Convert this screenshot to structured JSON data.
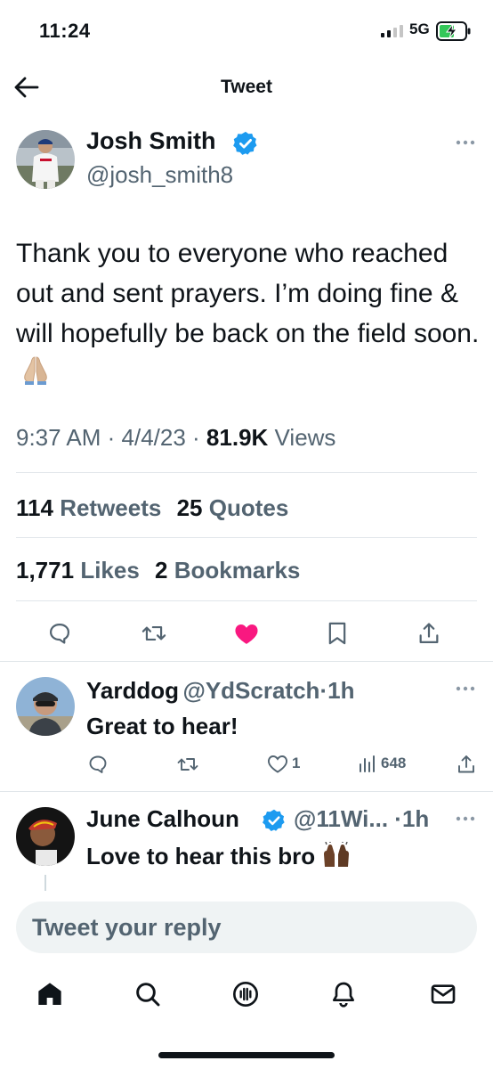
{
  "status_bar": {
    "time": "11:24",
    "network": "5G"
  },
  "header": {
    "title": "Tweet"
  },
  "tweet": {
    "author_name": "Josh Smith",
    "author_handle": "@josh_smith8",
    "text": "Thank you to everyone who reached out and sent prayers. I’m doing fine & will hopefully be back on the field soon.",
    "time": "9:37 AM",
    "date": "4/4/23",
    "views_count": "81.9K",
    "views_label": "Views",
    "retweets_count": "114",
    "retweets_label": "Retweets",
    "quotes_count": "25",
    "quotes_label": "Quotes",
    "likes_count": "1,771",
    "likes_label": "Likes",
    "bookmarks_count": "2",
    "bookmarks_label": "Bookmarks",
    "liked": true
  },
  "replies": [
    {
      "name": "Yarddog",
      "handle": "@YdScratch",
      "time": "1h",
      "text": "Great to hear!",
      "likes": "1",
      "views": "648"
    },
    {
      "name": "June Calhoun",
      "handle": "@11Wi...",
      "time": "1h",
      "text": "Love to hear this bro"
    }
  ],
  "composer": {
    "placeholder": "Tweet your reply"
  },
  "colors": {
    "accent": "#1d9bf0",
    "like": "#f91880",
    "secondary": "#536471"
  }
}
